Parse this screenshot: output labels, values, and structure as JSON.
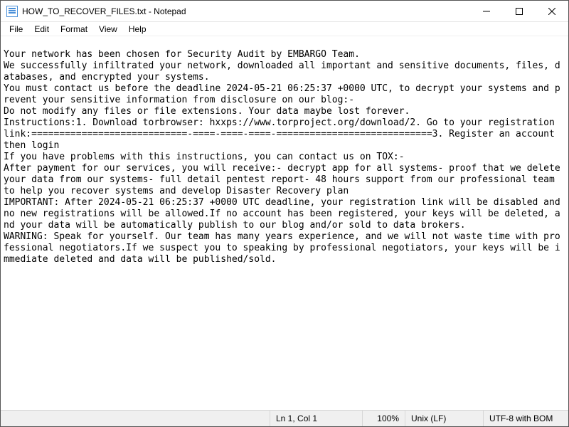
{
  "window": {
    "title": "HOW_TO_RECOVER_FILES.txt - Notepad"
  },
  "menu": {
    "file": "File",
    "edit": "Edit",
    "format": "Format",
    "view": "View",
    "help": "Help"
  },
  "editor": {
    "content": "\nYour network has been chosen for Security Audit by EMBARGO Team.\nWe successfully infiltrated your network, downloaded all important and sensitive documents, files, databases, and encrypted your systems.\nYou must contact us before the deadline 2024-05-21 06:25:37 +0000 UTC, to decrypt your systems and prevent your sensitive information from disclosure on our blog:-\nDo not modify any files or file extensions. Your data maybe lost forever.\nInstructions:1. Download torbrowser: hxxps://www.torproject.org/download/2. Go to your registration link:============================-====-====-====-============================3. Register an account then login\nIf you have problems with this instructions, you can contact us on TOX:-\nAfter payment for our services, you will receive:- decrypt app for all systems- proof that we delete your data from our systems- full detail pentest report- 48 hours support from our professional team to help you recover systems and develop Disaster Recovery plan\nIMPORTANT: After 2024-05-21 06:25:37 +0000 UTC deadline, your registration link will be disabled and no new registrations will be allowed.If no account has been registered, your keys will be deleted, and your data will be automatically publish to our blog and/or sold to data brokers.\nWARNING: Speak for yourself. Our team has many years experience, and we will not waste time with professional negotiators.If we suspect you to speaking by professional negotiators, your keys will be immediate deleted and data will be published/sold."
  },
  "status": {
    "position": "Ln 1, Col 1",
    "zoom": "100%",
    "eol": "Unix (LF)",
    "encoding": "UTF-8 with BOM"
  }
}
